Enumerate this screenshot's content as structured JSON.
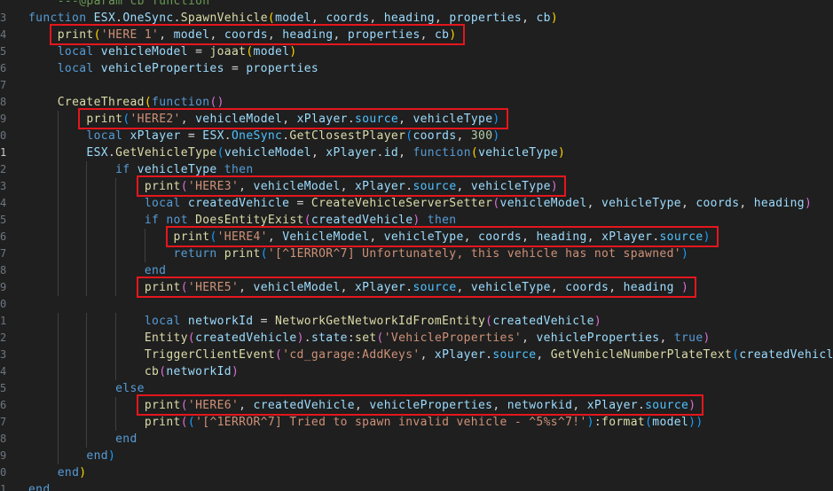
{
  "editor": {
    "colors": {
      "background": "#1f1f1f",
      "highlight_box": "#e5161d"
    },
    "lines": [
      {
        "num": "",
        "tokens": [
          [
            "cmt",
            "    ---@param cb function"
          ]
        ]
      },
      {
        "num": "3",
        "tokens": [
          [
            "kw",
            "function "
          ],
          [
            "var",
            "ESX"
          ],
          [
            "op",
            "."
          ],
          [
            "var",
            "OneSync"
          ],
          [
            "op",
            "."
          ],
          [
            "fn",
            "SpawnVehicle"
          ],
          [
            "br1",
            "("
          ],
          [
            "var",
            "model"
          ],
          [
            "op",
            ", "
          ],
          [
            "var",
            "coords"
          ],
          [
            "op",
            ", "
          ],
          [
            "var",
            "heading"
          ],
          [
            "op",
            ", "
          ],
          [
            "var",
            "properties"
          ],
          [
            "op",
            ", "
          ],
          [
            "var",
            "cb"
          ],
          [
            "br1",
            ")"
          ]
        ]
      },
      {
        "num": "4",
        "tokens": [
          [
            "op",
            "    "
          ],
          [
            "fn",
            "print"
          ],
          [
            "br1",
            "("
          ],
          [
            "str",
            "'HERE 1'"
          ],
          [
            "op",
            ", "
          ],
          [
            "var",
            "model"
          ],
          [
            "op",
            ", "
          ],
          [
            "var",
            "coords"
          ],
          [
            "op",
            ", "
          ],
          [
            "var",
            "heading"
          ],
          [
            "op",
            ", "
          ],
          [
            "var",
            "properties"
          ],
          [
            "op",
            ", "
          ],
          [
            "var",
            "cb"
          ],
          [
            "br1",
            ")"
          ]
        ]
      },
      {
        "num": "5",
        "tokens": [
          [
            "op",
            "    "
          ],
          [
            "kw",
            "local "
          ],
          [
            "var",
            "vehicleModel"
          ],
          [
            "op",
            " = "
          ],
          [
            "fn",
            "joaat"
          ],
          [
            "br1",
            "("
          ],
          [
            "var",
            "model"
          ],
          [
            "br1",
            ")"
          ]
        ]
      },
      {
        "num": "6",
        "tokens": [
          [
            "op",
            "    "
          ],
          [
            "kw",
            "local "
          ],
          [
            "var",
            "vehicleProperties"
          ],
          [
            "op",
            " = "
          ],
          [
            "var",
            "properties"
          ]
        ]
      },
      {
        "num": "7",
        "tokens": []
      },
      {
        "num": "8",
        "tokens": [
          [
            "op",
            "    "
          ],
          [
            "fn",
            "CreateThread"
          ],
          [
            "br1",
            "("
          ],
          [
            "kw",
            "function"
          ],
          [
            "br2",
            "()"
          ]
        ]
      },
      {
        "num": "9",
        "tokens": [
          [
            "op",
            "        "
          ],
          [
            "fn",
            "print"
          ],
          [
            "br3",
            "("
          ],
          [
            "str",
            "'HERE2'"
          ],
          [
            "op",
            ", "
          ],
          [
            "var",
            "vehicleModel"
          ],
          [
            "op",
            ", "
          ],
          [
            "var",
            "xPlayer"
          ],
          [
            "op",
            "."
          ],
          [
            "prop",
            "source"
          ],
          [
            "op",
            ", "
          ],
          [
            "var",
            "vehicleType"
          ],
          [
            "br3",
            ")"
          ]
        ]
      },
      {
        "num": "0",
        "tokens": [
          [
            "op",
            "        "
          ],
          [
            "kw",
            "local "
          ],
          [
            "var",
            "xPlayer"
          ],
          [
            "op",
            " = "
          ],
          [
            "var",
            "ESX"
          ],
          [
            "op",
            "."
          ],
          [
            "prop",
            "OneSync"
          ],
          [
            "op",
            "."
          ],
          [
            "fn",
            "GetClosestPlayer"
          ],
          [
            "br3",
            "("
          ],
          [
            "var",
            "coords"
          ],
          [
            "op",
            ", "
          ],
          [
            "num",
            "300"
          ],
          [
            "br3",
            ")"
          ]
        ]
      },
      {
        "num": "1",
        "active": true,
        "tokens": [
          [
            "op",
            "        "
          ],
          [
            "var",
            "ESX"
          ],
          [
            "op",
            "."
          ],
          [
            "fn",
            "GetVehicleType"
          ],
          [
            "br3",
            "("
          ],
          [
            "var",
            "vehicleModel"
          ],
          [
            "op",
            ", "
          ],
          [
            "var",
            "xPlayer"
          ],
          [
            "op",
            "."
          ],
          [
            "var",
            "id"
          ],
          [
            "op",
            ", "
          ],
          [
            "kw",
            "function"
          ],
          [
            "br1",
            "("
          ],
          [
            "var",
            "vehicleType"
          ],
          [
            "br1",
            ")"
          ]
        ]
      },
      {
        "num": "2",
        "tokens": [
          [
            "op",
            "            "
          ],
          [
            "kw",
            "if "
          ],
          [
            "var",
            "vehicleType"
          ],
          [
            "kw",
            " then"
          ]
        ]
      },
      {
        "num": "3",
        "tokens": [
          [
            "op",
            "                "
          ],
          [
            "fn",
            "print"
          ],
          [
            "br2",
            "("
          ],
          [
            "str",
            "'HERE3'"
          ],
          [
            "op",
            ", "
          ],
          [
            "var",
            "vehicleModel"
          ],
          [
            "op",
            ", "
          ],
          [
            "var",
            "xPlayer"
          ],
          [
            "op",
            "."
          ],
          [
            "prop",
            "source"
          ],
          [
            "op",
            ", "
          ],
          [
            "var",
            "vehicleType"
          ],
          [
            "br2",
            ")"
          ]
        ]
      },
      {
        "num": "4",
        "tokens": [
          [
            "op",
            "                "
          ],
          [
            "kw",
            "local "
          ],
          [
            "var",
            "createdVehicle"
          ],
          [
            "op",
            " = "
          ],
          [
            "fn",
            "CreateVehicleServerSetter"
          ],
          [
            "br2",
            "("
          ],
          [
            "var",
            "vehicleModel"
          ],
          [
            "op",
            ", "
          ],
          [
            "var",
            "vehicleType"
          ],
          [
            "op",
            ", "
          ],
          [
            "var",
            "coords"
          ],
          [
            "op",
            ", "
          ],
          [
            "var",
            "heading"
          ],
          [
            "br2",
            ")"
          ]
        ]
      },
      {
        "num": "5",
        "tokens": [
          [
            "op",
            "                "
          ],
          [
            "kw",
            "if not "
          ],
          [
            "fn",
            "DoesEntityExist"
          ],
          [
            "br2",
            "("
          ],
          [
            "var",
            "createdVehicle"
          ],
          [
            "br2",
            ")"
          ],
          [
            "kw",
            " then"
          ]
        ]
      },
      {
        "num": "6",
        "tokens": [
          [
            "op",
            "                    "
          ],
          [
            "fn",
            "print"
          ],
          [
            "br3",
            "("
          ],
          [
            "str",
            "'HERE4'"
          ],
          [
            "op",
            ", "
          ],
          [
            "var",
            "VehicleModel"
          ],
          [
            "op",
            ", "
          ],
          [
            "var",
            "vehicleType"
          ],
          [
            "op",
            ", "
          ],
          [
            "var",
            "coords"
          ],
          [
            "op",
            ", "
          ],
          [
            "var",
            "heading"
          ],
          [
            "op",
            ", "
          ],
          [
            "var",
            "xPlayer"
          ],
          [
            "op",
            "."
          ],
          [
            "prop",
            "source"
          ],
          [
            "br3",
            ")"
          ]
        ]
      },
      {
        "num": "7",
        "tokens": [
          [
            "op",
            "                    "
          ],
          [
            "kw",
            "return "
          ],
          [
            "fn",
            "print"
          ],
          [
            "br3",
            "("
          ],
          [
            "str",
            "'[^1ERROR^7] Unfortunately, this vehicle has not spawned'"
          ],
          [
            "br3",
            ")"
          ]
        ]
      },
      {
        "num": "8",
        "tokens": [
          [
            "op",
            "                "
          ],
          [
            "kw",
            "end"
          ]
        ]
      },
      {
        "num": "9",
        "tokens": [
          [
            "op",
            "                "
          ],
          [
            "fn",
            "print"
          ],
          [
            "br2",
            "("
          ],
          [
            "str",
            "'HERE5'"
          ],
          [
            "op",
            ", "
          ],
          [
            "var",
            "vehicleModel"
          ],
          [
            "op",
            ", "
          ],
          [
            "var",
            "xPlayer"
          ],
          [
            "op",
            "."
          ],
          [
            "prop",
            "source"
          ],
          [
            "op",
            ", "
          ],
          [
            "var",
            "vehicleType"
          ],
          [
            "op",
            ", "
          ],
          [
            "var",
            "coords"
          ],
          [
            "op",
            ", "
          ],
          [
            "var",
            "heading"
          ],
          [
            "op",
            " "
          ],
          [
            "br2",
            ")"
          ]
        ]
      },
      {
        "num": "0",
        "tokens": []
      },
      {
        "num": "1",
        "tokens": [
          [
            "op",
            "                "
          ],
          [
            "kw",
            "local "
          ],
          [
            "var",
            "networkId"
          ],
          [
            "op",
            " = "
          ],
          [
            "fn",
            "NetworkGetNetworkIdFromEntity"
          ],
          [
            "br2",
            "("
          ],
          [
            "var",
            "createdVehicle"
          ],
          [
            "br2",
            ")"
          ]
        ]
      },
      {
        "num": "2",
        "tokens": [
          [
            "op",
            "                "
          ],
          [
            "fn",
            "Entity"
          ],
          [
            "br2",
            "("
          ],
          [
            "var",
            "createdVehicle"
          ],
          [
            "br2",
            ")"
          ],
          [
            "op",
            "."
          ],
          [
            "var",
            "state"
          ],
          [
            "op",
            ":"
          ],
          [
            "fn",
            "set"
          ],
          [
            "br2",
            "("
          ],
          [
            "str",
            "'VehicleProperties'"
          ],
          [
            "op",
            ", "
          ],
          [
            "var",
            "vehicleProperties"
          ],
          [
            "op",
            ", "
          ],
          [
            "kw",
            "true"
          ],
          [
            "br2",
            ")"
          ]
        ]
      },
      {
        "num": "3",
        "tokens": [
          [
            "op",
            "                "
          ],
          [
            "fn",
            "TriggerClientEvent"
          ],
          [
            "br2",
            "("
          ],
          [
            "str",
            "'cd_garage:AddKeys'"
          ],
          [
            "op",
            ", "
          ],
          [
            "var",
            "xPlayer"
          ],
          [
            "op",
            "."
          ],
          [
            "prop",
            "source"
          ],
          [
            "op",
            ", "
          ],
          [
            "fn",
            "GetVehicleNumberPlateText"
          ],
          [
            "br3",
            "("
          ],
          [
            "var",
            "createdVehicle"
          ],
          [
            "br3",
            "))"
          ]
        ]
      },
      {
        "num": "4",
        "tokens": [
          [
            "op",
            "                "
          ],
          [
            "fn",
            "cb"
          ],
          [
            "br2",
            "("
          ],
          [
            "var",
            "networkId"
          ],
          [
            "br2",
            ")"
          ]
        ]
      },
      {
        "num": "5",
        "tokens": [
          [
            "op",
            "            "
          ],
          [
            "kw",
            "else"
          ]
        ]
      },
      {
        "num": "6",
        "tokens": [
          [
            "op",
            "                "
          ],
          [
            "fn",
            "print"
          ],
          [
            "br2",
            "("
          ],
          [
            "str",
            "'HERE6'"
          ],
          [
            "op",
            ", "
          ],
          [
            "var",
            "createdVehicle"
          ],
          [
            "op",
            ", "
          ],
          [
            "var",
            "vehicleProperties"
          ],
          [
            "op",
            ", "
          ],
          [
            "var",
            "networkid"
          ],
          [
            "op",
            ", "
          ],
          [
            "var",
            "xPlayer"
          ],
          [
            "op",
            "."
          ],
          [
            "prop",
            "source"
          ],
          [
            "br2",
            ")"
          ]
        ]
      },
      {
        "num": "7",
        "tokens": [
          [
            "op",
            "                "
          ],
          [
            "fn",
            "print"
          ],
          [
            "br2",
            "("
          ],
          [
            "br3",
            "("
          ],
          [
            "str",
            "'[^1ERROR^7] Tried to spawn invalid vehicle - ^5%s^7!'"
          ],
          [
            "br3",
            ")"
          ],
          [
            "op",
            ":"
          ],
          [
            "fn",
            "format"
          ],
          [
            "br3",
            "("
          ],
          [
            "var",
            "model"
          ],
          [
            "br3",
            "))"
          ]
        ]
      },
      {
        "num": "8",
        "tokens": [
          [
            "op",
            "            "
          ],
          [
            "kw",
            "end"
          ]
        ]
      },
      {
        "num": "9",
        "tokens": [
          [
            "op",
            "        "
          ],
          [
            "kw",
            "end"
          ],
          [
            "br3",
            ")"
          ]
        ]
      },
      {
        "num": "0",
        "tokens": [
          [
            "op",
            "    "
          ],
          [
            "kw",
            "end"
          ],
          [
            "br1",
            ")"
          ]
        ]
      },
      {
        "num": "1",
        "tokens": [
          [
            "kw",
            "end"
          ]
        ]
      }
    ]
  }
}
